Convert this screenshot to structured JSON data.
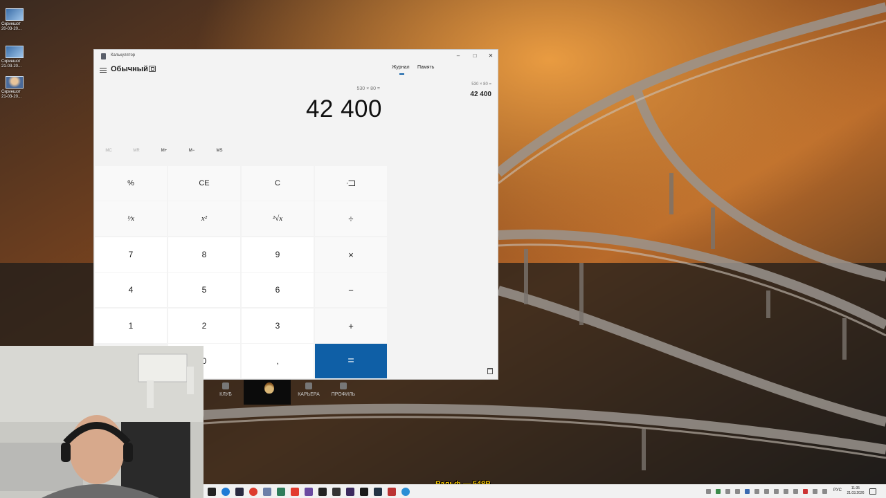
{
  "desktop": {
    "icons": [
      {
        "label_1": "Скриншот",
        "label_2": "20-03-20...",
        "icon": "image-file-icon"
      },
      {
        "label_1": "Скриншот",
        "label_2": "21-03-20...",
        "icon": "image-file-icon"
      },
      {
        "label_1": "Скриншот",
        "label_2": "21-03-20...",
        "icon": "image-file-icon"
      }
    ]
  },
  "calculator": {
    "window_title": "Калькулятор",
    "mode": "Обычный",
    "expression": "530 × 80 =",
    "display": "42 400",
    "memory_buttons": [
      "MC",
      "MR",
      "M+",
      "M−",
      "MS"
    ],
    "keys": {
      "percent": "%",
      "ce": "CE",
      "c": "C",
      "reciprocal": "¹⁄x",
      "square": "x²",
      "sqrt": "²√x",
      "divide": "÷",
      "seven": "7",
      "eight": "8",
      "nine": "9",
      "multiply": "×",
      "four": "4",
      "five": "5",
      "six": "6",
      "minus": "−",
      "one": "1",
      "two": "2",
      "three": "3",
      "plus": "+",
      "zero": "0",
      "decimal": ",",
      "equals": "="
    },
    "tabs": {
      "history": "Журнал",
      "memory": "Память"
    },
    "history": [
      {
        "expression": "530 × 80 =",
        "result": "42 400"
      }
    ]
  },
  "game_overlay": {
    "items": [
      "КЛУБ",
      "КАРЬЕРА",
      "ПРОФИЛЬ"
    ]
  },
  "stream": {
    "label": "Ральф — 548Р"
  },
  "taskbar": {
    "language": "РУС",
    "time": "11:35",
    "date": "21.03.2026"
  }
}
